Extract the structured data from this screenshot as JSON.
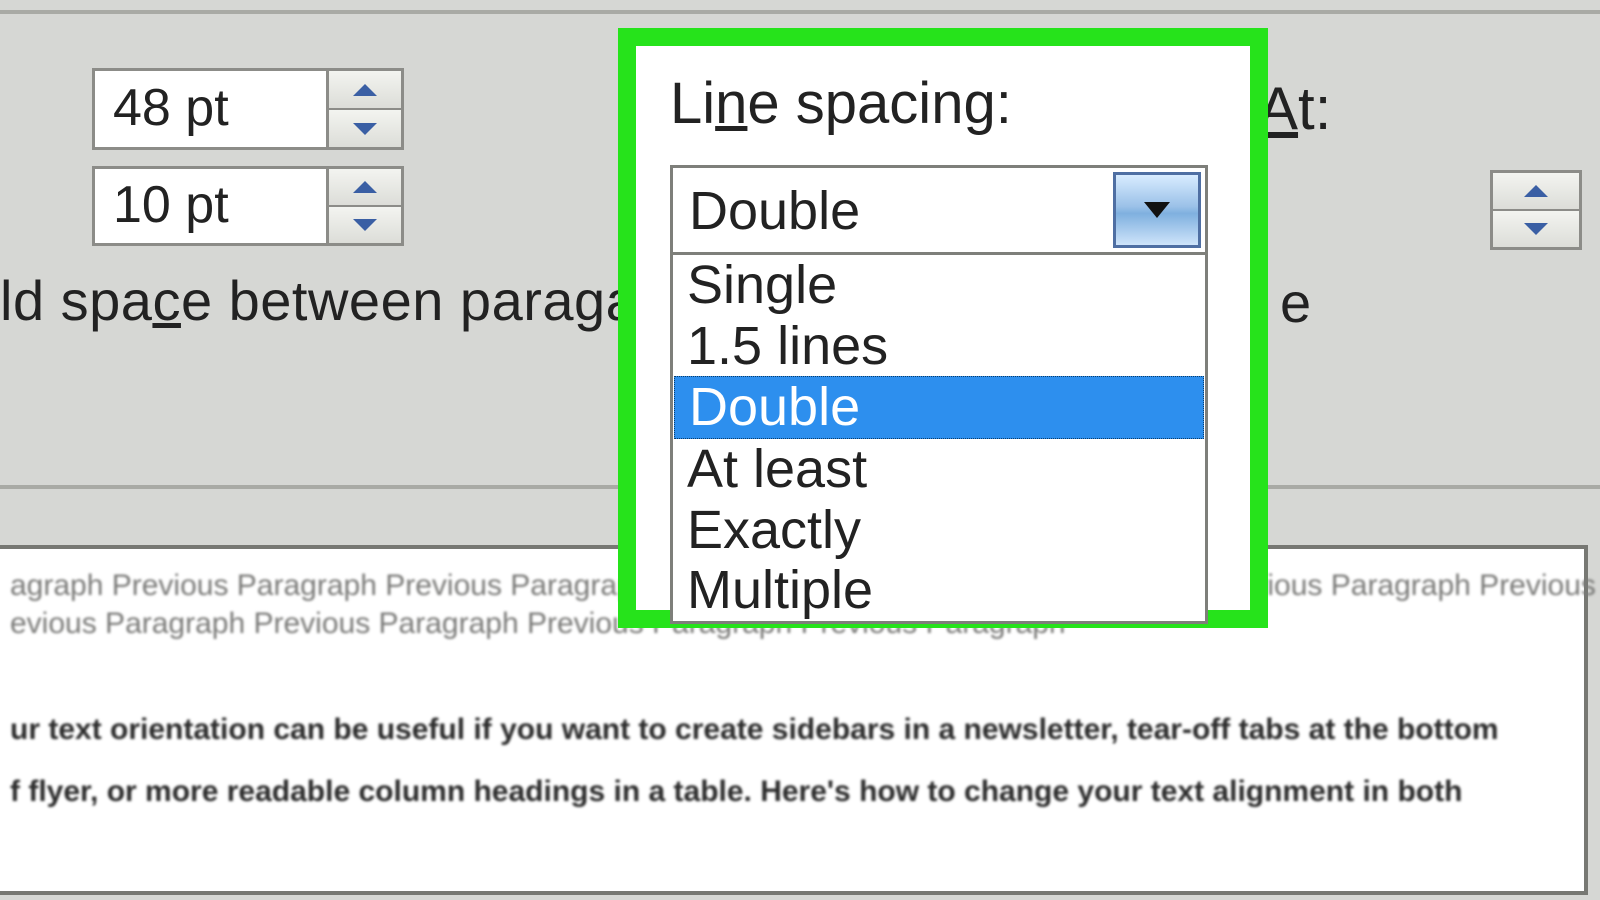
{
  "spacing": {
    "before_value": "48 pt",
    "after_value": "10 pt"
  },
  "checkbox_line": {
    "fragment_left": "ld spa",
    "fragment_c": "c",
    "fragment_right": "e between parag",
    "fragment_right2": "ap",
    "style_fragment": "e"
  },
  "line_spacing": {
    "label_prefix": "Li",
    "label_underline": "n",
    "label_suffix": "e spacing:",
    "selected": "Double",
    "options": [
      "Single",
      "1.5 lines",
      "Double",
      "At least",
      "Exactly",
      "Multiple"
    ],
    "selected_index": 2
  },
  "at": {
    "label_underline": "A",
    "label_suffix": "t:",
    "value": ""
  },
  "preview": {
    "grey1": "agraph Previous Paragraph Previous Paragraph Previous Paragraph Previous Paragraph Previous Paragraph Previous Paragraph",
    "grey2": "evious Paragraph Previous Paragraph Previous Paragraph Previous Paragraph",
    "body1": "ur text orientation can be useful if you want to create sidebars in a newsletter, tear-off tabs at the bottom",
    "body2": "f flyer, or more readable column headings in a table. Here's how to change your text alignment in both"
  }
}
